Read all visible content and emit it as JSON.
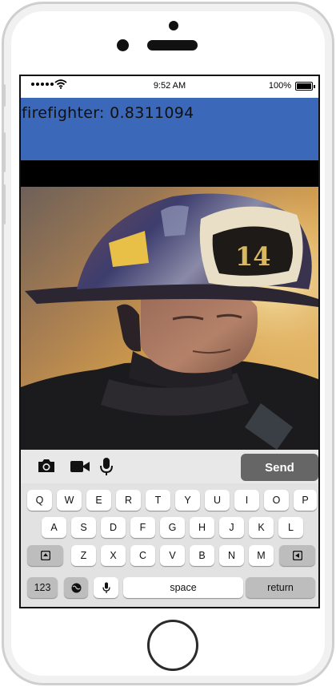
{
  "status_bar": {
    "time": "9:52 AM",
    "battery": "100%",
    "icons": [
      "signal-dots-icon",
      "wifi-icon",
      "battery-icon"
    ]
  },
  "header": {
    "prediction": "firefighter: 0.8311094",
    "color": "#3b68b9"
  },
  "photo": {
    "helmet_number": "14"
  },
  "input_bar": {
    "send_label": "Send",
    "icons": [
      "camera-icon",
      "video-icon",
      "mic-icon"
    ]
  },
  "keyboard": {
    "row1": [
      "Q",
      "W",
      "E",
      "R",
      "T",
      "Y",
      "U",
      "I",
      "O",
      "P"
    ],
    "row2": [
      "A",
      "S",
      "D",
      "F",
      "G",
      "H",
      "J",
      "K",
      "L"
    ],
    "row3": [
      "Z",
      "X",
      "C",
      "V",
      "B",
      "N",
      "M"
    ],
    "numbers": "123",
    "space": "space",
    "return": "return",
    "icons": [
      "shift-icon",
      "backspace-icon",
      "globe-icon",
      "dictation-mic-icon"
    ]
  }
}
